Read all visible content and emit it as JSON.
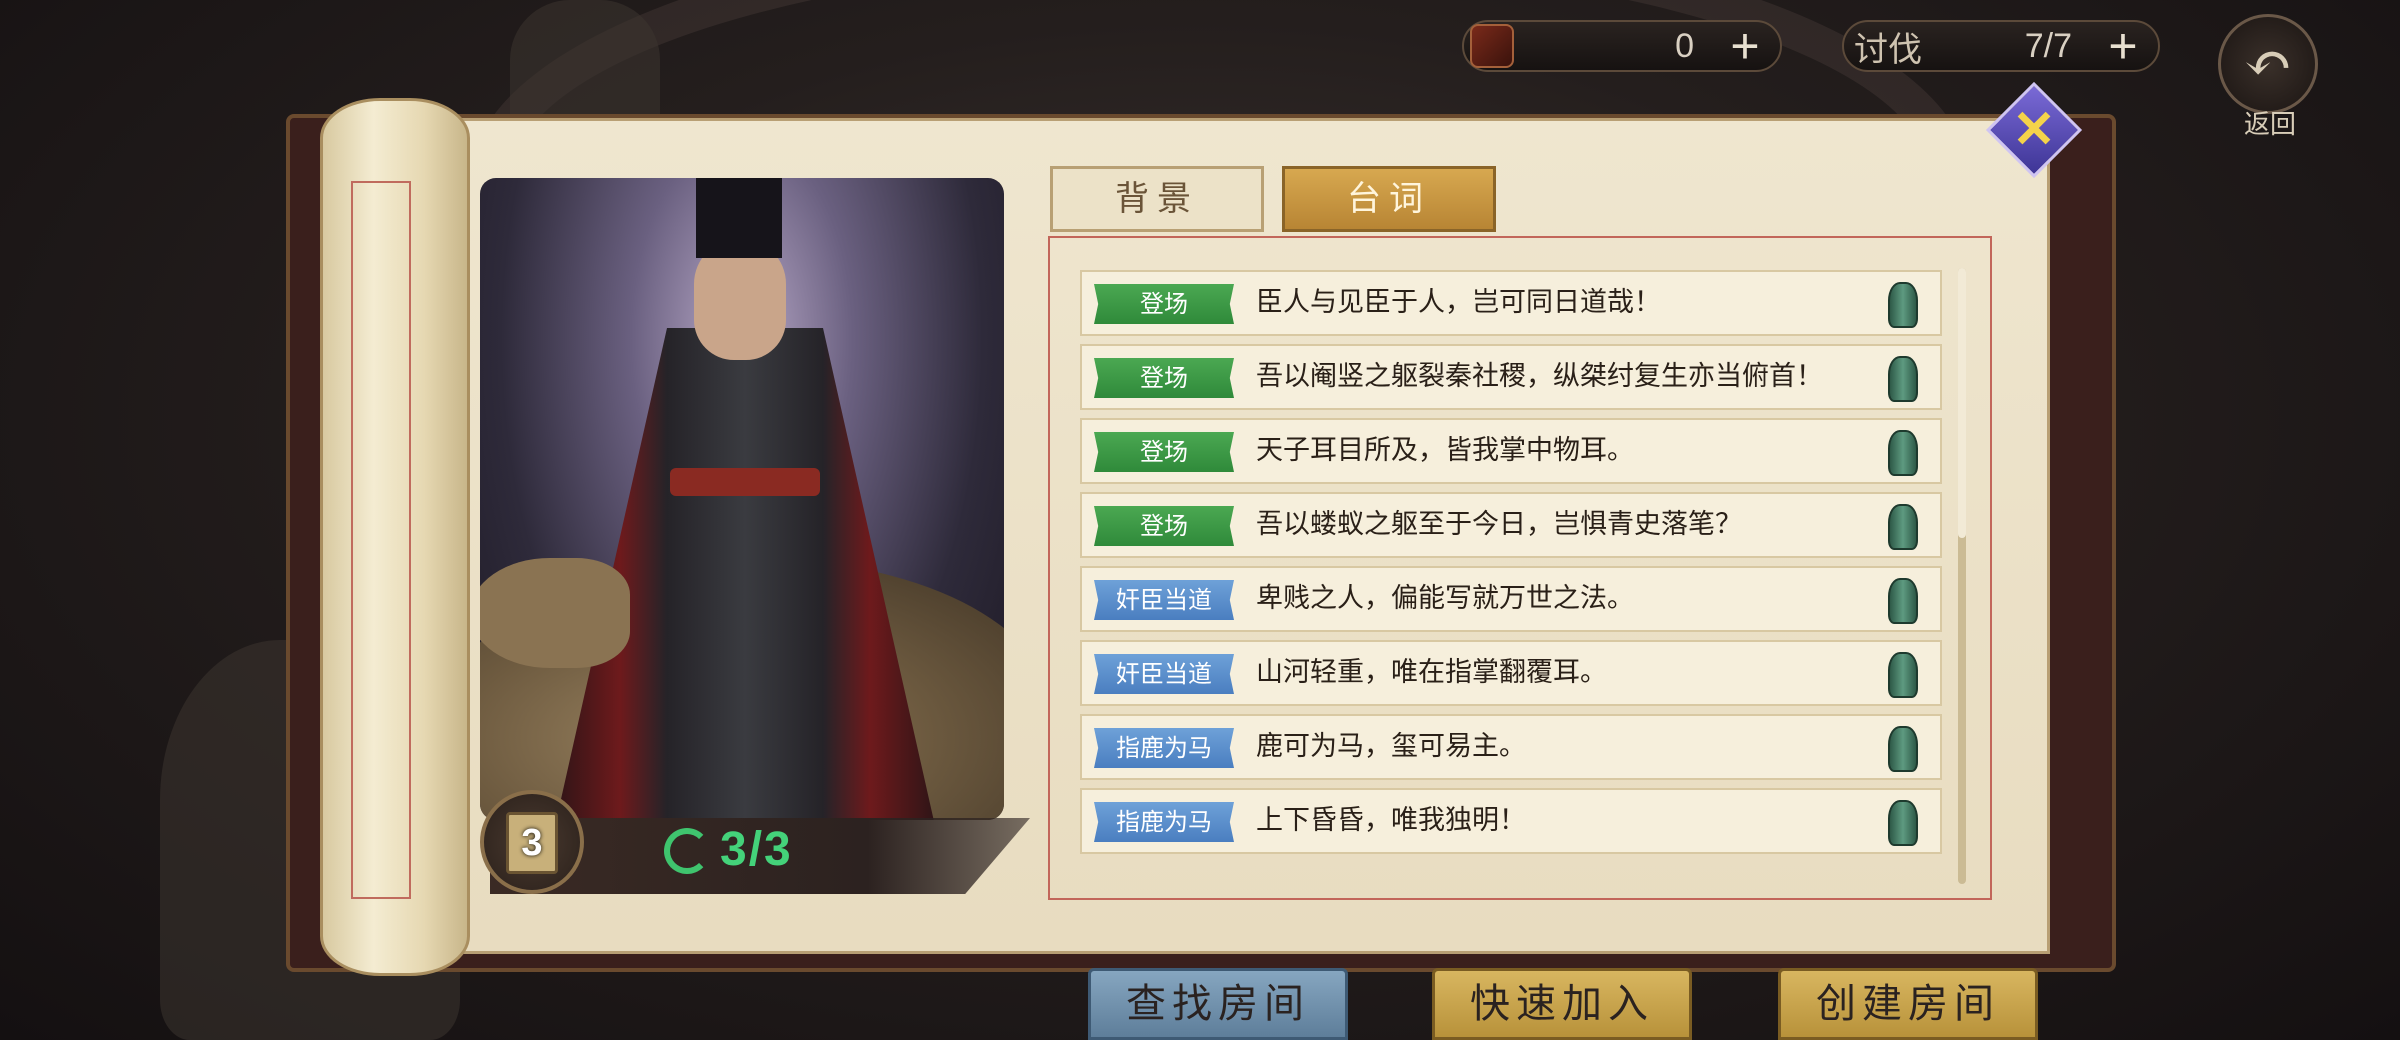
{
  "top_bar": {
    "resource": {
      "icon": "hero-token-icon",
      "value": "0"
    },
    "crusade": {
      "label": "讨伐",
      "value": "7/7"
    },
    "plus_symbol": "+",
    "back": {
      "icon": "back-arrow-icon",
      "label": "返回"
    }
  },
  "book": {
    "tabs": [
      {
        "label": "背景",
        "active": false
      },
      {
        "label": "台词",
        "active": true
      }
    ],
    "close_icon": "close-icon",
    "portrait": {
      "level": "3",
      "skin_count": "3/3"
    },
    "lines": [
      {
        "tag": "登场",
        "tag_color": "#3f9e48",
        "text": "臣人与见臣于人，岂可同日道哉！"
      },
      {
        "tag": "登场",
        "tag_color": "#3f9e48",
        "text": "吾以阉竖之躯裂秦社稷，纵桀纣复生亦当俯首！"
      },
      {
        "tag": "登场",
        "tag_color": "#3f9e48",
        "text": "天子耳目所及，皆我掌中物耳。"
      },
      {
        "tag": "登场",
        "tag_color": "#3f9e48",
        "text": "吾以蝼蚁之躯至于今日，岂惧青史落笔？"
      },
      {
        "tag": "奸臣当道",
        "tag_color": "#5b8fcf",
        "text": "卑贱之人，偏能写就万世之法。"
      },
      {
        "tag": "奸臣当道",
        "tag_color": "#5b8fcf",
        "text": "山河轻重，唯在指掌翻覆耳。"
      },
      {
        "tag": "指鹿为马",
        "tag_color": "#5b8fcf",
        "text": "鹿可为马，玺可易主。"
      },
      {
        "tag": "指鹿为马",
        "tag_color": "#5b8fcf",
        "text": "上下昏昏，唯我独明！"
      }
    ]
  },
  "bottom_buttons": {
    "find_room": "查找房间",
    "quick_join": "快速加入",
    "create_room": "创建房间"
  }
}
